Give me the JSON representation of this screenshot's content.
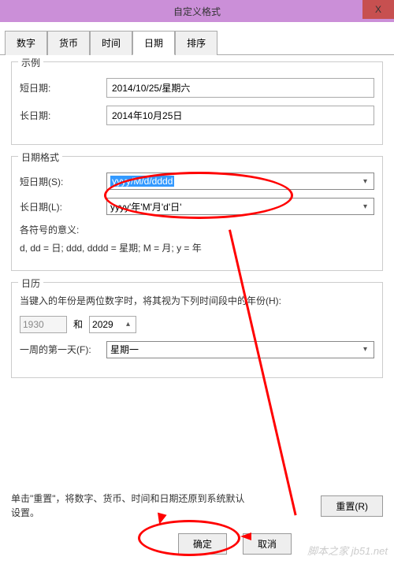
{
  "window": {
    "title": "自定义格式",
    "closeSymbol": "X"
  },
  "tabs": {
    "t1": "数字",
    "t2": "货币",
    "t3": "时间",
    "t4": "日期",
    "t5": "排序"
  },
  "example": {
    "title": "示例",
    "shortLabel": "短日期:",
    "shortValue": "2014/10/25/星期六",
    "longLabel": "长日期:",
    "longValue": "2014年10月25日"
  },
  "format": {
    "title": "日期格式",
    "shortLabel": "短日期(S):",
    "shortValue": "yyyy/M/d/dddd",
    "longLabel": "长日期(L):",
    "longValue": "yyyy'年'M'月'd'日'",
    "hintTitle": "各符号的意义:",
    "hintBody": "d, dd = 日;  ddd, dddd = 星期;  M = 月;  y = 年"
  },
  "calendar": {
    "title": "日历",
    "twoDigit": "当键入的年份是两位数字时，将其视为下列时间段中的年份(H):",
    "year1": "1930",
    "and": "和",
    "year2": "2029",
    "firstDayLabel": "一周的第一天(F):",
    "firstDayValue": "星期一"
  },
  "footer": {
    "text": "单击\"重置\"，将数字、货币、时间和日期还原到系统默认设置。",
    "reset": "重置(R)",
    "ok": "确定",
    "cancel": "取消"
  },
  "watermark": "脚本之家 jb51.net"
}
